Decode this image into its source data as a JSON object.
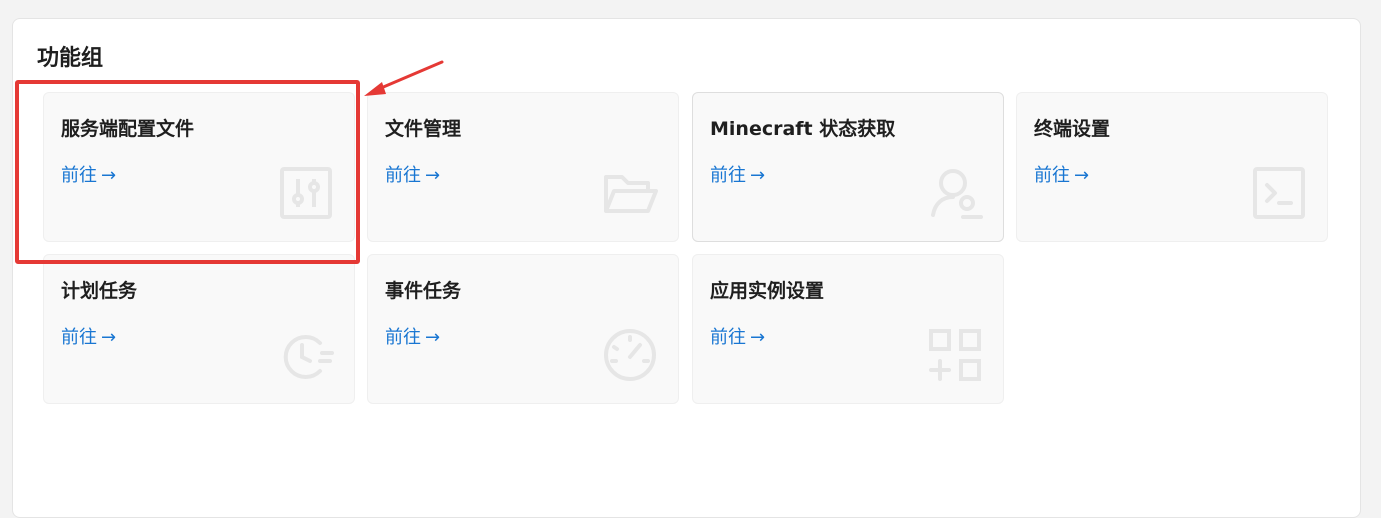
{
  "section": {
    "title": "功能组"
  },
  "cards": [
    {
      "title": "服务端配置文件",
      "link": "前往",
      "icon": "sliders-icon"
    },
    {
      "title": "文件管理",
      "link": "前往",
      "icon": "folder-open-icon"
    },
    {
      "title": "Minecraft 状态获取",
      "link": "前往",
      "icon": "user-search-icon"
    },
    {
      "title": "终端设置",
      "link": "前往",
      "icon": "terminal-icon"
    },
    {
      "title": "计划任务",
      "link": "前往",
      "icon": "clock-list-icon"
    },
    {
      "title": "事件任务",
      "link": "前往",
      "icon": "speedometer-icon"
    },
    {
      "title": "应用实例设置",
      "link": "前往",
      "icon": "apps-add-icon"
    }
  ],
  "arrow_glyph": "→",
  "colors": {
    "link": "#1976d2",
    "highlight": "#e53935",
    "icon": "#e8e8e8"
  }
}
